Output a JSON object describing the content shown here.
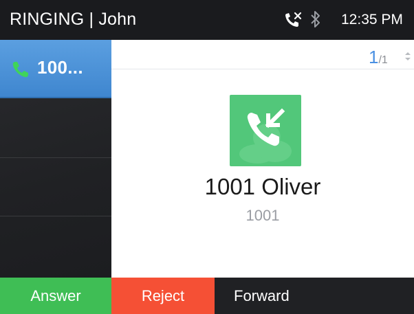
{
  "status_bar": {
    "title": "RINGING | John",
    "time": "12:35 PM",
    "icons": [
      "missed-call-icon",
      "bluetooth-icon"
    ]
  },
  "sidebar": {
    "lines": [
      {
        "label": "100...",
        "active": true,
        "icon": "phone-icon"
      },
      {
        "label": "",
        "active": false
      },
      {
        "label": "",
        "active": false
      },
      {
        "label": "",
        "active": false
      }
    ]
  },
  "main": {
    "pager": {
      "current": "1",
      "total": "/1"
    },
    "caller": {
      "name": "1001 Oliver",
      "number": "1001",
      "icon": "incoming-call-icon"
    }
  },
  "softkeys": {
    "answer": "Answer",
    "reject": "Reject",
    "forward": "Forward"
  },
  "colors": {
    "active_line": "#4a90e2",
    "answer": "#3fbe55",
    "reject": "#f55035",
    "call_icon_bg": "#52c77a"
  }
}
